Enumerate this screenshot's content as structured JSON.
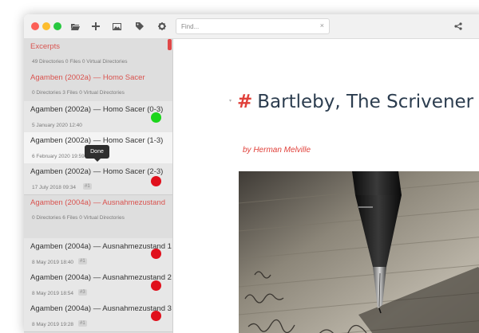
{
  "colors": {
    "close": "#fc5f57",
    "minimize": "#fdbd2e",
    "maximize": "#28c840",
    "accent": "#e0403a",
    "status_done": "#1bd51b",
    "status_todo": "#e0101c"
  },
  "toolbar": {
    "icons": [
      "folder-open-icon",
      "plus-icon",
      "image-icon",
      "tag-icon",
      "gear-icon",
      "share-icon"
    ],
    "search_placeholder": "Find...",
    "clear_glyph": "×"
  },
  "sidebar": {
    "items": [
      {
        "kind": "dir",
        "name": "Excerpts",
        "meta": "49 Directories   0 Files   0 Virtual Directories"
      },
      {
        "kind": "dir",
        "name": "Agamben (2002a) — Homo Sacer",
        "meta": "0 Directories   3 Files   0 Virtual Directories"
      },
      {
        "kind": "file",
        "name": "Agamben (2002a) — Homo Sacer (0-3)",
        "date": "5 January 2020 12:40",
        "status": "done"
      },
      {
        "kind": "file",
        "name": "Agamben (2002a) — Homo Sacer (1-3)",
        "date": "6 February 2020 19:59",
        "tag": "#1",
        "status": "done"
      },
      {
        "kind": "file",
        "name": "Agamben (2002a) — Homo Sacer (2-3)",
        "date": "17 July 2018 09:34",
        "tag": "#1",
        "status": "todo"
      },
      {
        "kind": "dir",
        "name": "Agamben (2004a) — Ausnahmezustand",
        "meta": "0 Directories   6 Files   0 Virtual Directories"
      },
      {
        "kind": "file",
        "name": "Agamben (2004a) — Ausnahmezustand 1",
        "date": "8 May 2019 18:40",
        "tag": "#1",
        "status": "todo"
      },
      {
        "kind": "file",
        "name": "Agamben (2004a) — Ausnahmezustand 2",
        "date": "8 May 2019 18:54",
        "tag": "#3",
        "status": "todo"
      },
      {
        "kind": "file",
        "name": "Agamben (2004a) — Ausnahmezustand 3",
        "date": "8 May 2019 19:28",
        "tag": "#1",
        "status": "todo"
      }
    ],
    "tooltip": "Done"
  },
  "editor": {
    "heading_hash": "#",
    "heading": "Bartleby, The Scrivener",
    "byline": "by Herman Melville",
    "fold_glyph": "▾",
    "image": "fountain-pen-writing-photo"
  }
}
